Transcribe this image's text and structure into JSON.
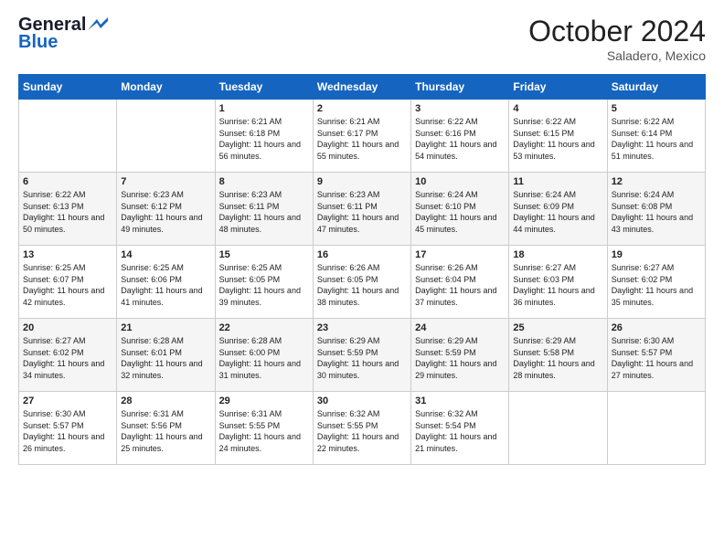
{
  "logo": {
    "line1": "General",
    "line2": "Blue"
  },
  "title": "October 2024",
  "location": "Saladero, Mexico",
  "days_header": [
    "Sunday",
    "Monday",
    "Tuesday",
    "Wednesday",
    "Thursday",
    "Friday",
    "Saturday"
  ],
  "weeks": [
    [
      {
        "day": "",
        "sunrise": "",
        "sunset": "",
        "daylight": ""
      },
      {
        "day": "",
        "sunrise": "",
        "sunset": "",
        "daylight": ""
      },
      {
        "day": "1",
        "sunrise": "Sunrise: 6:21 AM",
        "sunset": "Sunset: 6:18 PM",
        "daylight": "Daylight: 11 hours and 56 minutes."
      },
      {
        "day": "2",
        "sunrise": "Sunrise: 6:21 AM",
        "sunset": "Sunset: 6:17 PM",
        "daylight": "Daylight: 11 hours and 55 minutes."
      },
      {
        "day": "3",
        "sunrise": "Sunrise: 6:22 AM",
        "sunset": "Sunset: 6:16 PM",
        "daylight": "Daylight: 11 hours and 54 minutes."
      },
      {
        "day": "4",
        "sunrise": "Sunrise: 6:22 AM",
        "sunset": "Sunset: 6:15 PM",
        "daylight": "Daylight: 11 hours and 53 minutes."
      },
      {
        "day": "5",
        "sunrise": "Sunrise: 6:22 AM",
        "sunset": "Sunset: 6:14 PM",
        "daylight": "Daylight: 11 hours and 51 minutes."
      }
    ],
    [
      {
        "day": "6",
        "sunrise": "Sunrise: 6:22 AM",
        "sunset": "Sunset: 6:13 PM",
        "daylight": "Daylight: 11 hours and 50 minutes."
      },
      {
        "day": "7",
        "sunrise": "Sunrise: 6:23 AM",
        "sunset": "Sunset: 6:12 PM",
        "daylight": "Daylight: 11 hours and 49 minutes."
      },
      {
        "day": "8",
        "sunrise": "Sunrise: 6:23 AM",
        "sunset": "Sunset: 6:11 PM",
        "daylight": "Daylight: 11 hours and 48 minutes."
      },
      {
        "day": "9",
        "sunrise": "Sunrise: 6:23 AM",
        "sunset": "Sunset: 6:11 PM",
        "daylight": "Daylight: 11 hours and 47 minutes."
      },
      {
        "day": "10",
        "sunrise": "Sunrise: 6:24 AM",
        "sunset": "Sunset: 6:10 PM",
        "daylight": "Daylight: 11 hours and 45 minutes."
      },
      {
        "day": "11",
        "sunrise": "Sunrise: 6:24 AM",
        "sunset": "Sunset: 6:09 PM",
        "daylight": "Daylight: 11 hours and 44 minutes."
      },
      {
        "day": "12",
        "sunrise": "Sunrise: 6:24 AM",
        "sunset": "Sunset: 6:08 PM",
        "daylight": "Daylight: 11 hours and 43 minutes."
      }
    ],
    [
      {
        "day": "13",
        "sunrise": "Sunrise: 6:25 AM",
        "sunset": "Sunset: 6:07 PM",
        "daylight": "Daylight: 11 hours and 42 minutes."
      },
      {
        "day": "14",
        "sunrise": "Sunrise: 6:25 AM",
        "sunset": "Sunset: 6:06 PM",
        "daylight": "Daylight: 11 hours and 41 minutes."
      },
      {
        "day": "15",
        "sunrise": "Sunrise: 6:25 AM",
        "sunset": "Sunset: 6:05 PM",
        "daylight": "Daylight: 11 hours and 39 minutes."
      },
      {
        "day": "16",
        "sunrise": "Sunrise: 6:26 AM",
        "sunset": "Sunset: 6:05 PM",
        "daylight": "Daylight: 11 hours and 38 minutes."
      },
      {
        "day": "17",
        "sunrise": "Sunrise: 6:26 AM",
        "sunset": "Sunset: 6:04 PM",
        "daylight": "Daylight: 11 hours and 37 minutes."
      },
      {
        "day": "18",
        "sunrise": "Sunrise: 6:27 AM",
        "sunset": "Sunset: 6:03 PM",
        "daylight": "Daylight: 11 hours and 36 minutes."
      },
      {
        "day": "19",
        "sunrise": "Sunrise: 6:27 AM",
        "sunset": "Sunset: 6:02 PM",
        "daylight": "Daylight: 11 hours and 35 minutes."
      }
    ],
    [
      {
        "day": "20",
        "sunrise": "Sunrise: 6:27 AM",
        "sunset": "Sunset: 6:02 PM",
        "daylight": "Daylight: 11 hours and 34 minutes."
      },
      {
        "day": "21",
        "sunrise": "Sunrise: 6:28 AM",
        "sunset": "Sunset: 6:01 PM",
        "daylight": "Daylight: 11 hours and 32 minutes."
      },
      {
        "day": "22",
        "sunrise": "Sunrise: 6:28 AM",
        "sunset": "Sunset: 6:00 PM",
        "daylight": "Daylight: 11 hours and 31 minutes."
      },
      {
        "day": "23",
        "sunrise": "Sunrise: 6:29 AM",
        "sunset": "Sunset: 5:59 PM",
        "daylight": "Daylight: 11 hours and 30 minutes."
      },
      {
        "day": "24",
        "sunrise": "Sunrise: 6:29 AM",
        "sunset": "Sunset: 5:59 PM",
        "daylight": "Daylight: 11 hours and 29 minutes."
      },
      {
        "day": "25",
        "sunrise": "Sunrise: 6:29 AM",
        "sunset": "Sunset: 5:58 PM",
        "daylight": "Daylight: 11 hours and 28 minutes."
      },
      {
        "day": "26",
        "sunrise": "Sunrise: 6:30 AM",
        "sunset": "Sunset: 5:57 PM",
        "daylight": "Daylight: 11 hours and 27 minutes."
      }
    ],
    [
      {
        "day": "27",
        "sunrise": "Sunrise: 6:30 AM",
        "sunset": "Sunset: 5:57 PM",
        "daylight": "Daylight: 11 hours and 26 minutes."
      },
      {
        "day": "28",
        "sunrise": "Sunrise: 6:31 AM",
        "sunset": "Sunset: 5:56 PM",
        "daylight": "Daylight: 11 hours and 25 minutes."
      },
      {
        "day": "29",
        "sunrise": "Sunrise: 6:31 AM",
        "sunset": "Sunset: 5:55 PM",
        "daylight": "Daylight: 11 hours and 24 minutes."
      },
      {
        "day": "30",
        "sunrise": "Sunrise: 6:32 AM",
        "sunset": "Sunset: 5:55 PM",
        "daylight": "Daylight: 11 hours and 22 minutes."
      },
      {
        "day": "31",
        "sunrise": "Sunrise: 6:32 AM",
        "sunset": "Sunset: 5:54 PM",
        "daylight": "Daylight: 11 hours and 21 minutes."
      },
      {
        "day": "",
        "sunrise": "",
        "sunset": "",
        "daylight": ""
      },
      {
        "day": "",
        "sunrise": "",
        "sunset": "",
        "daylight": ""
      }
    ]
  ]
}
